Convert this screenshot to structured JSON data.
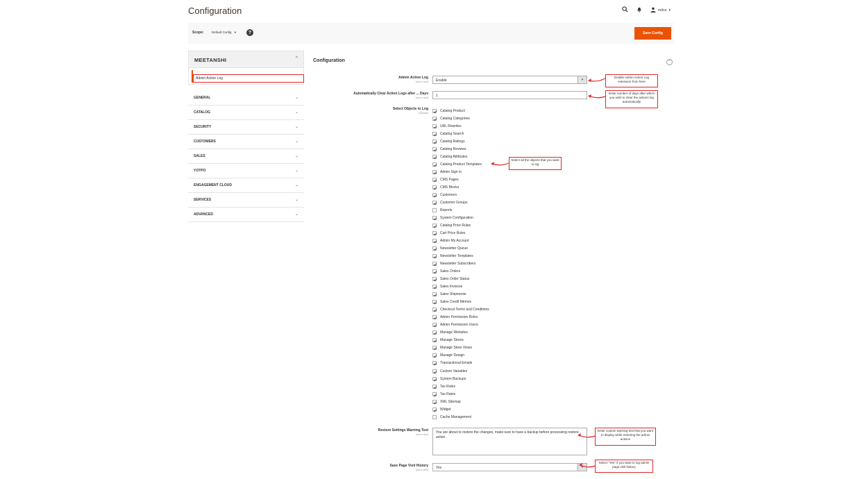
{
  "header": {
    "title": "Configuration",
    "user": "mdoo"
  },
  "scope": {
    "label": "Scope:",
    "value": "Default Config",
    "save_label": "Save Config"
  },
  "sidebar": {
    "brand": "MEETANSHI",
    "active_item": "Admin Action Log",
    "items": [
      {
        "label": "GENERAL"
      },
      {
        "label": "CATALOG"
      },
      {
        "label": "SECURITY"
      },
      {
        "label": "CUSTOMERS"
      },
      {
        "label": "SALES"
      },
      {
        "label": "YOTPO"
      },
      {
        "label": "ENGAGEMENT CLOUD"
      },
      {
        "label": "SERVICES"
      },
      {
        "label": "ADVANCED"
      }
    ]
  },
  "main": {
    "section_title": "Configuration",
    "admin_action_log": {
      "label": "Admin Action Log",
      "scope": "[store view]",
      "value": "Enable"
    },
    "clear_logs": {
      "label": "Automatically Clear Action Logs after ... Days",
      "scope": "[store view]",
      "value": "1"
    },
    "objects": {
      "label": "Select Objects to Log",
      "scope": "[website]",
      "options": [
        {
          "label": "Catalog Product",
          "checked": true
        },
        {
          "label": "Catalog Categories",
          "checked": true
        },
        {
          "label": "URL Rewrites",
          "checked": true
        },
        {
          "label": "Catalog Search",
          "checked": true
        },
        {
          "label": "Catalog Ratings",
          "checked": true
        },
        {
          "label": "Catalog Reviews",
          "checked": true
        },
        {
          "label": "Catalog Attributes",
          "checked": true
        },
        {
          "label": "Catalog Product Templates",
          "checked": true
        },
        {
          "label": "Admin Sign In",
          "checked": true
        },
        {
          "label": "CMS Pages",
          "checked": true
        },
        {
          "label": "CMS Blocks",
          "checked": true
        },
        {
          "label": "Customers",
          "checked": true
        },
        {
          "label": "Customer Groups",
          "checked": true
        },
        {
          "label": "Reports",
          "checked": false
        },
        {
          "label": "System Configuration",
          "checked": true
        },
        {
          "label": "Catalog Price Rules",
          "checked": true
        },
        {
          "label": "Cart Price Rules",
          "checked": true
        },
        {
          "label": "Admin My Account",
          "checked": true
        },
        {
          "label": "Newsletter Queue",
          "checked": true
        },
        {
          "label": "Newsletter Templates",
          "checked": true
        },
        {
          "label": "Newsletter Subscribers",
          "checked": true
        },
        {
          "label": "Sales Orders",
          "checked": true
        },
        {
          "label": "Sales Order Status",
          "checked": true
        },
        {
          "label": "Sales Invoices",
          "checked": true
        },
        {
          "label": "Sales Shipments",
          "checked": true
        },
        {
          "label": "Sales Credit Memos",
          "checked": true
        },
        {
          "label": "Checkout Terms and Conditions",
          "checked": true
        },
        {
          "label": "Admin Permission Roles",
          "checked": true
        },
        {
          "label": "Admin Permission Users",
          "checked": true
        },
        {
          "label": "Manage Websites",
          "checked": true
        },
        {
          "label": "Manage Stores",
          "checked": true
        },
        {
          "label": "Manage Store Views",
          "checked": true
        },
        {
          "label": "Manage Design",
          "checked": true
        },
        {
          "label": "Transactional Emails",
          "checked": true
        },
        {
          "label": "Custom Variables",
          "checked": true
        },
        {
          "label": "System Backups",
          "checked": true
        },
        {
          "label": "Tax Rules",
          "checked": true
        },
        {
          "label": "Tax Rates",
          "checked": true
        },
        {
          "label": "XML Sitemap",
          "checked": true
        },
        {
          "label": "Widget",
          "checked": true
        },
        {
          "label": "Cache Management",
          "checked": false
        }
      ]
    },
    "restore_warning": {
      "label": "Restore Settings Warning Text",
      "scope": "[store view]",
      "value": "You are about to restore the changes, make sure to have a backup before processing restore action."
    },
    "page_visit": {
      "label": "Save Page Visit History",
      "scope": "[store view]",
      "value": "Yes"
    }
  },
  "callouts": {
    "enable": "Enable Admin Action Log extension from here",
    "days": "Enter number of days after which you wish to clear the actions log automatically",
    "objects": "Select all the objects that you want to log",
    "warning": "Enter custom warning text that you want to display while restoring the admin actions",
    "history": "Select \"Yes\" if you want to log admin page visit history"
  },
  "colors": {
    "accent": "#eb5202",
    "callout_border": "#e22626"
  }
}
